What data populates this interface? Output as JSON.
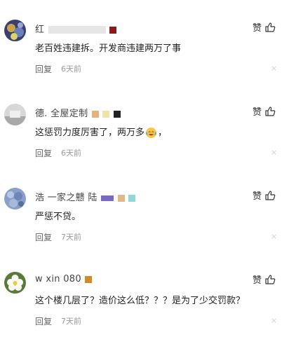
{
  "like_label": "赞",
  "reply_label": "回复",
  "close_glyph": "×",
  "comments": [
    {
      "name": "红",
      "text": "老百姓违建拆。开发商违建两万了事",
      "time": "6天前"
    },
    {
      "name": "德. 全屋定制",
      "text": "这惩罚力度厉害了，两万多",
      "text_suffix": "，",
      "time": "6天前"
    },
    {
      "name": "浩 一家之戆 陆",
      "text": "严惩不贷。",
      "time": "7天前"
    },
    {
      "name": "w  xin  080",
      "text": "这个楼几层了？造价这么低？？？是为了少交罚款？",
      "time": "7天前"
    }
  ]
}
